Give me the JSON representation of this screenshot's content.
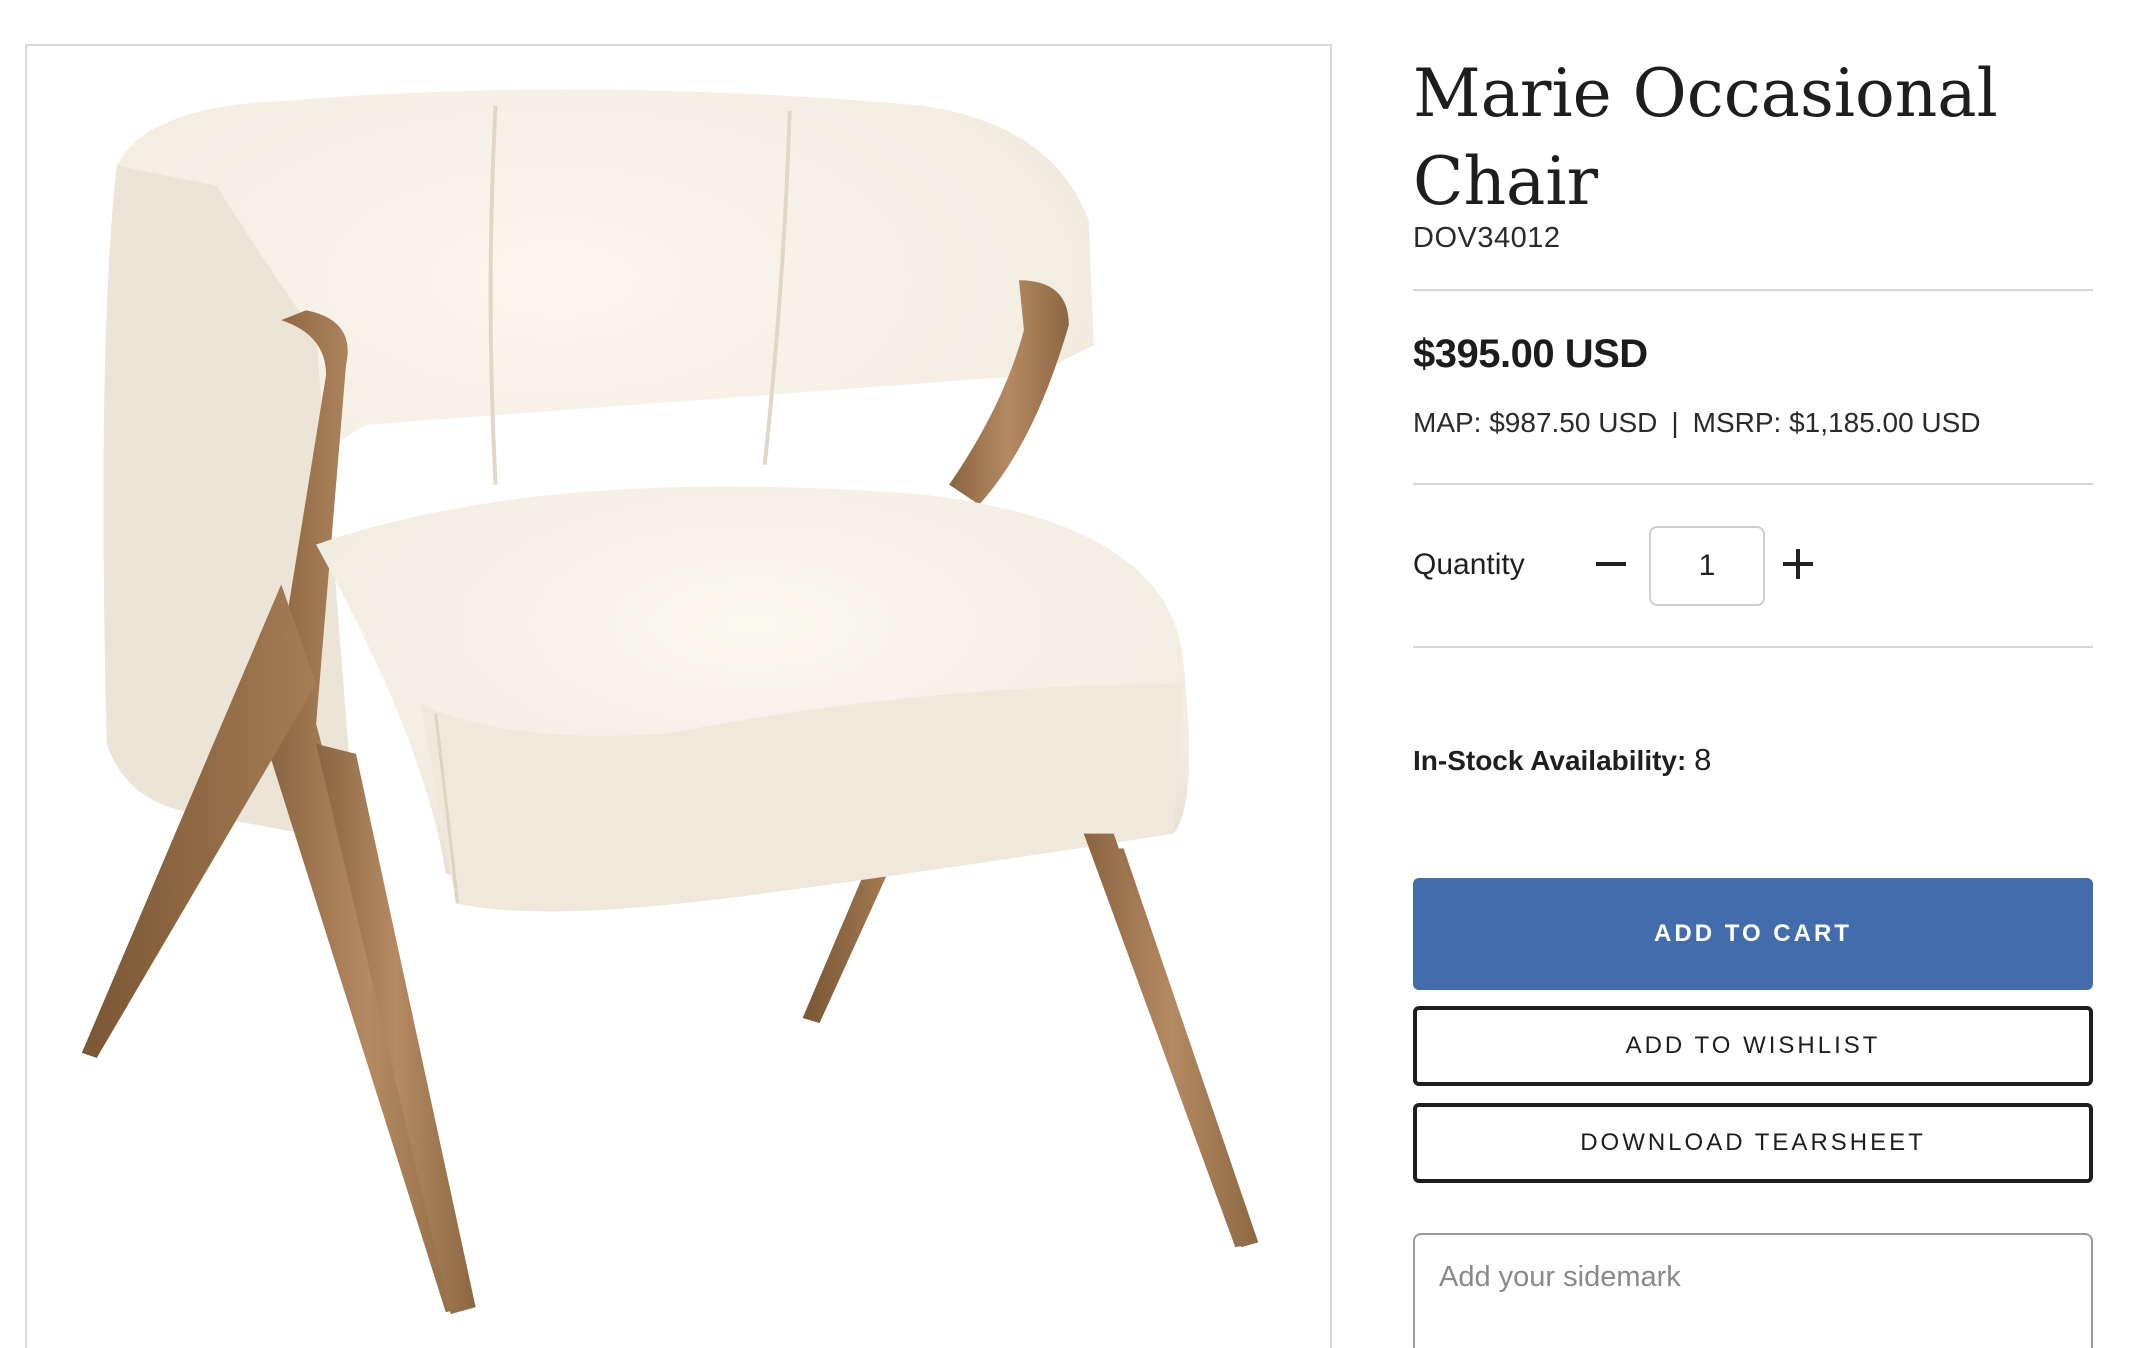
{
  "product": {
    "image_alt": "Marie Occasional Chair",
    "title": "Marie Occasional Chair",
    "sku": "DOV34012",
    "price": "$395.00 USD",
    "map": "MAP: $987.50 USD",
    "separator": "|",
    "msrp": "MSRP: $1,185.00 USD"
  },
  "quantity": {
    "label": "Quantity",
    "value": "1"
  },
  "stock": {
    "label": "In-Stock Availability:",
    "value": "8"
  },
  "buttons": {
    "add_to_cart": "ADD TO CART",
    "add_to_wishlist": "ADD TO WISHLIST",
    "download_tearsheet": "DOWNLOAD TEARSHEET"
  },
  "sidemark": {
    "placeholder": "Add your sidemark"
  },
  "colors": {
    "primary_button": "#426cab",
    "text": "#1e1e1e",
    "divider": "#d6d6d6"
  }
}
